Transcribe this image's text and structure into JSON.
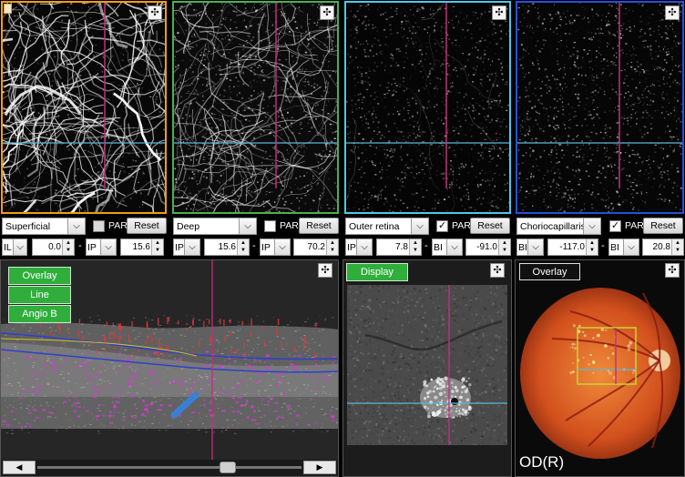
{
  "panels": [
    {
      "id": "superficial",
      "border": "#f39c12",
      "layer": "Superficial",
      "par_checked": false,
      "par_label": "PAR",
      "reset_label": "Reset",
      "range": {
        "start_code": "IL",
        "start_value": "0.0",
        "end_code": "IP",
        "end_value": "15.6"
      }
    },
    {
      "id": "deep",
      "border": "#4caf50",
      "layer": "Deep",
      "par_checked": false,
      "par_label": "PAR",
      "reset_label": "Reset",
      "range": {
        "start_code": "IP",
        "start_value": "15.6",
        "end_code": "IP",
        "end_value": "70.2"
      }
    },
    {
      "id": "outer",
      "border": "#4ec9e6",
      "layer": "Outer retina",
      "par_checked": true,
      "par_label": "PAR",
      "reset_label": "Reset",
      "range": {
        "start_code": "IP",
        "start_value": "7.8",
        "end_code": "BI",
        "end_value": "-91.0"
      }
    },
    {
      "id": "chorio",
      "border": "#2b4fd6",
      "layer": "Choriocapillaris",
      "par_checked": true,
      "par_label": "PAR",
      "reset_label": "Reset",
      "range": {
        "start_code": "BI",
        "start_value": "-117.0",
        "end_code": "BI",
        "end_value": "20.8"
      }
    }
  ],
  "bscan": {
    "buttons": [
      "Overlay",
      "Line",
      "Angio B"
    ]
  },
  "enface": {
    "display_label": "Display"
  },
  "fundus": {
    "overlay_label": "Overlay",
    "eye_label": "OD(R)"
  },
  "colors": {
    "flow": "#d03ccf",
    "cursor_v": "#c0307a",
    "cursor_h": "#5bb7d9",
    "arrow": "#3a7fd6",
    "button_green": "#2fae3c"
  },
  "icons": [
    "maximize-icon",
    "chevron-down-icon",
    "spinner-icon",
    "scroll-left-icon",
    "scroll-right-icon",
    "corner-tab-icon"
  ]
}
